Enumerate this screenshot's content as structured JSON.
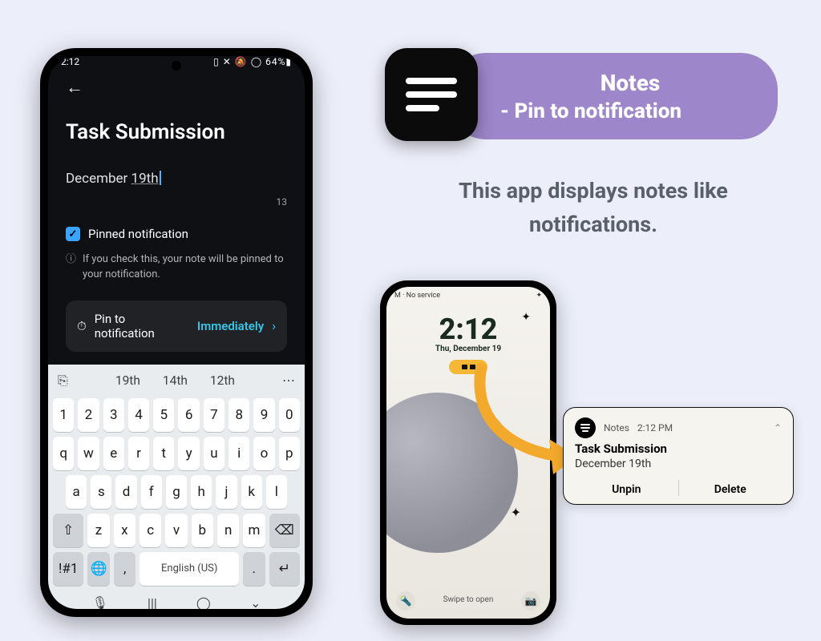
{
  "phone1": {
    "status_time": "2:12",
    "status_right": "64%",
    "title": "Task Submission",
    "body_prefix": "December ",
    "body_underlined": "19th",
    "char_count": "13",
    "pinned_label": "Pinned notification",
    "hint_text": "If you check this, your note will be pinned to your notification.",
    "pin_label": "Pin to notification",
    "pin_value": "Immediately"
  },
  "keyboard": {
    "suggestions": [
      "19th",
      "14th",
      "12th"
    ],
    "row_num": [
      "1",
      "2",
      "3",
      "4",
      "5",
      "6",
      "7",
      "8",
      "9",
      "0"
    ],
    "row1": [
      "q",
      "w",
      "e",
      "r",
      "t",
      "y",
      "u",
      "i",
      "o",
      "p"
    ],
    "row2": [
      "a",
      "s",
      "d",
      "f",
      "g",
      "h",
      "j",
      "k",
      "l"
    ],
    "row3_mid": [
      "z",
      "x",
      "c",
      "v",
      "b",
      "n",
      "m"
    ],
    "shift": "⇧",
    "backspace": "⌫",
    "sym": "!#1",
    "globe": "🌐",
    "comma": ",",
    "space": "English (US)",
    "period": ".",
    "enter": "↵",
    "mic": "🎙",
    "nav": [
      "|||",
      "◯",
      "⌄"
    ]
  },
  "header": {
    "app_name": "Notes",
    "feature": "- Pin to notification"
  },
  "tagline": "This app displays notes like notifications.",
  "lock": {
    "status_left": "M · No service",
    "time": "2:12",
    "date": "Thu, December 19",
    "swipe": "Swipe to open"
  },
  "notif": {
    "app": "Notes",
    "time": "2:12 PM",
    "title": "Task Submission",
    "body": "December 19th",
    "action_unpin": "Unpin",
    "action_delete": "Delete"
  }
}
